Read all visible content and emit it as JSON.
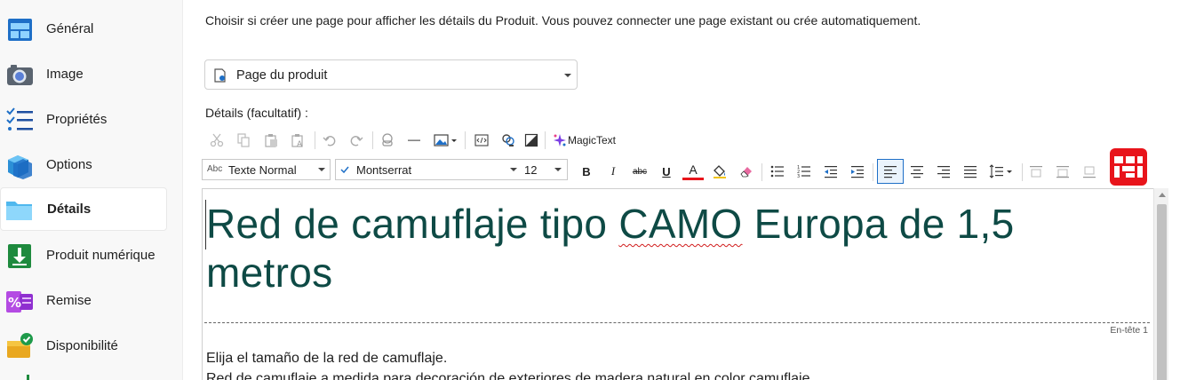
{
  "sidebar": {
    "items": [
      {
        "label": "Général",
        "icon": "layout-window-icon"
      },
      {
        "label": "Image",
        "icon": "camera-icon"
      },
      {
        "label": "Propriétés",
        "icon": "checklist-icon"
      },
      {
        "label": "Options",
        "icon": "stacked-cubes-icon"
      },
      {
        "label": "Détails",
        "icon": "folder-icon",
        "active": true
      },
      {
        "label": "Produit numérique",
        "icon": "download-icon"
      },
      {
        "label": "Remise",
        "icon": "percent-icon"
      },
      {
        "label": "Disponibilité",
        "icon": "available-box-icon"
      }
    ]
  },
  "main": {
    "intro": "Choisir si créer une page pour afficher les détails du Produit. Vous pouvez connecter une page existant ou crée automatiquement.",
    "page_select_value": "Page du produit",
    "details_label": "Détails (facultatif) :"
  },
  "toolbar": {
    "magic_text": "MagicText",
    "style_prefix": "Abc",
    "style_value": "Texte Normal",
    "font_value": "Montserrat",
    "size_value": "12",
    "bold": "B",
    "italic": "I",
    "strike": "abc",
    "underline": "U",
    "font_color": "A"
  },
  "editor": {
    "heading_part1": "Red de camuflaje tipo ",
    "heading_misspelled": "CAMO",
    "heading_part2": " Europa de 1,5 metros",
    "heading_tag": "En-tête 1",
    "paragraph1": "Elija el tamaño de la red de camuflaje.",
    "paragraph2": "Red de camuflaje a medida para decoración de exteriores de madera natural en color camuflaje."
  },
  "colors": {
    "heading_text": "#0e4a45",
    "accent_blue": "#1e6fc7",
    "brand_red": "#e8141b"
  }
}
